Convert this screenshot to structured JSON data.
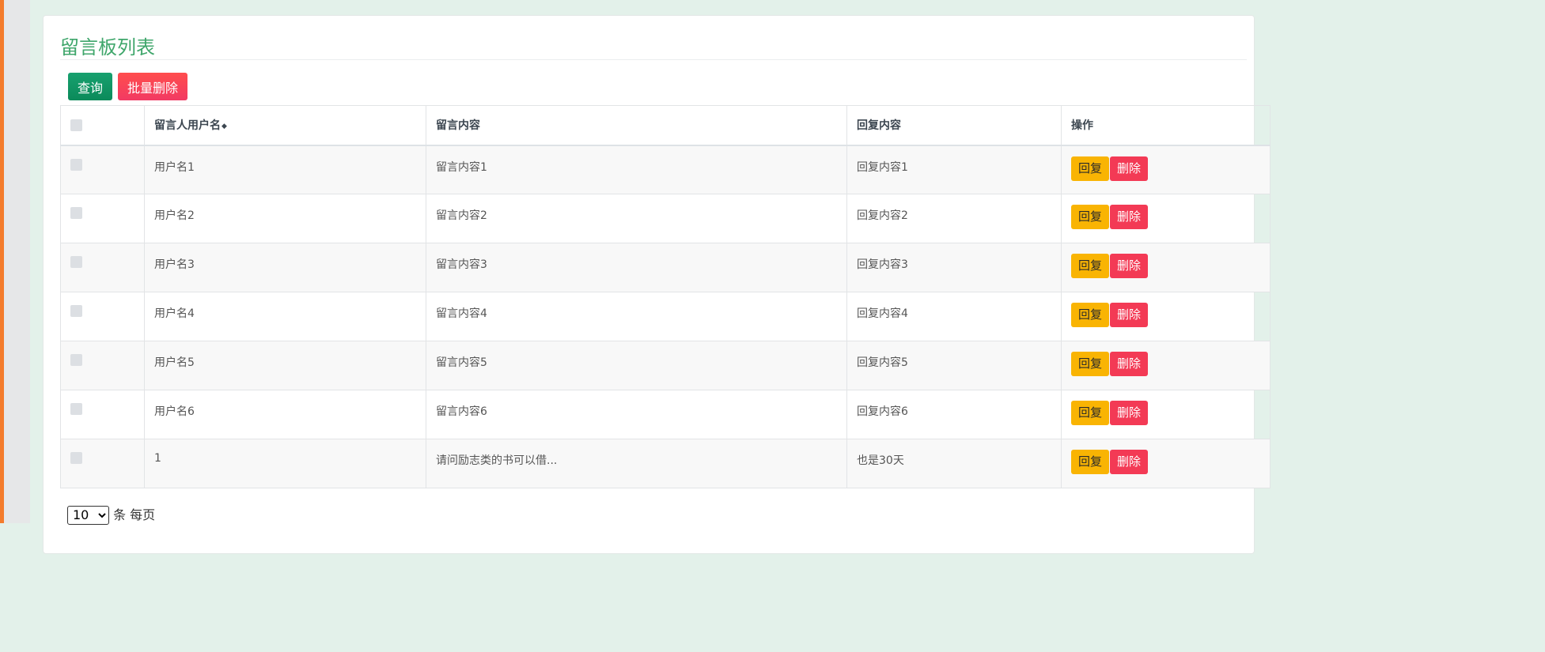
{
  "page": {
    "title": "留言板列表"
  },
  "toolbar": {
    "query_label": "查询",
    "batch_delete_label": "批量删除"
  },
  "table": {
    "columns": [
      "",
      "留言人用户名",
      "留言内容",
      "回复内容",
      "操作"
    ],
    "rows": [
      {
        "username": "用户名1",
        "content": "留言内容1",
        "reply": "回复内容1"
      },
      {
        "username": "用户名2",
        "content": "留言内容2",
        "reply": "回复内容2"
      },
      {
        "username": "用户名3",
        "content": "留言内容3",
        "reply": "回复内容3"
      },
      {
        "username": "用户名4",
        "content": "留言内容4",
        "reply": "回复内容4"
      },
      {
        "username": "用户名5",
        "content": "留言内容5",
        "reply": "回复内容5"
      },
      {
        "username": "用户名6",
        "content": "留言内容6",
        "reply": "回复内容6"
      },
      {
        "username": "1",
        "content": "请问励志类的书可以借...",
        "reply": "也是30天"
      }
    ],
    "actions": {
      "reply_label": "回复",
      "delete_label": "删除"
    }
  },
  "pagination": {
    "page_size": "10",
    "suffix": "条 每页"
  },
  "colors": {
    "title": "#3fa66b",
    "query_button": "#0b8a5a",
    "batch_delete_button": "#f23a63",
    "reply_button": "#f9b403",
    "delete_button": "#f33a55",
    "sidebar_accent": "#f47c2c"
  },
  "icons": {
    "sort": "sort-icon"
  }
}
